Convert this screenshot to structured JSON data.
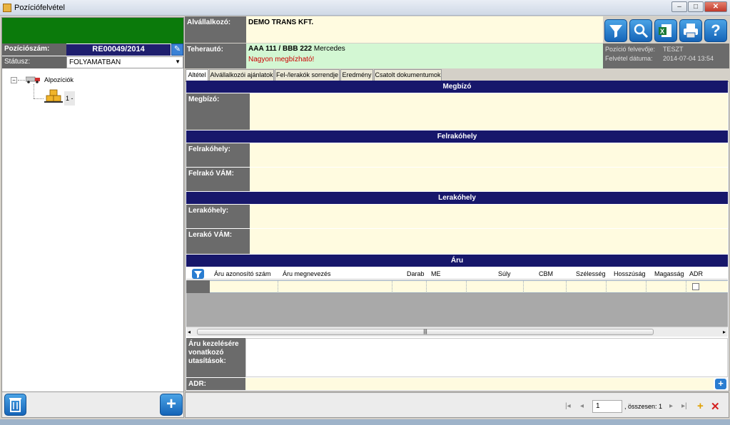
{
  "window": {
    "title": "Pozíciófelvétel"
  },
  "left": {
    "pozicioszam_label": "Pozíciószám:",
    "pozicioszam_value": "RE00049/2014",
    "status_label": "Státusz:",
    "status_value": "FOLYAMATBAN",
    "tree": {
      "root": "Alpozíciók",
      "child": "1 -"
    }
  },
  "header": {
    "alvallalkozo_label": "Alvállalkozó:",
    "alvallalkozo_value": "DEMO TRANS KFT.",
    "teherauto_label": "Teherautó:",
    "teherauto_plate": "AAA 111 / BBB 222",
    "teherauto_model": " Mercedes",
    "warning": "Nagyon megbízható!",
    "felvevo_label": "Pozíció felvevője:",
    "felvevo_value": "TESZT",
    "datum_label": "Felvétel dátuma:",
    "datum_value": "2014-07-04 13:54"
  },
  "tabs": [
    "Altétel",
    "Alvállalkozói ajánlatok",
    "Fel-/lerakók sorrendje",
    "Eredmény",
    "Csatolt dokumentumok"
  ],
  "sections": {
    "megbizo": "Megbízó",
    "megbizo_label": "Megbízó:",
    "felrakohely": "Felrakóhely",
    "felrakohely_label": "Felrakóhely:",
    "felrako_vam_label": "Felrakó VÁM:",
    "lerakohely": "Lerakóhely",
    "lerakohely_label": "Lerakóhely:",
    "lerako_vam_label": "Lerakó VÁM:",
    "aru": "Áru"
  },
  "grid": {
    "columns": [
      "Áru azonosító szám",
      "Áru megnevezés",
      "Darab",
      "ME",
      "Súly",
      "CBM",
      "Szélesség",
      "Hosszúság",
      "Magasság",
      "ADR"
    ]
  },
  "bottom": {
    "kezeles_label": "Áru kezelésére vonatkozó utasítások:",
    "adr_label": "ADR:"
  },
  "pager": {
    "page": "1",
    "total_text": ", összesen: 1"
  },
  "colors": {
    "green": "#0b7a0b",
    "navy": "#17176b",
    "label_gray": "#6b6b6b",
    "field_yellow": "#fffbe0",
    "warning_red": "#cc0000",
    "button_blue": "#1f7fd4"
  }
}
